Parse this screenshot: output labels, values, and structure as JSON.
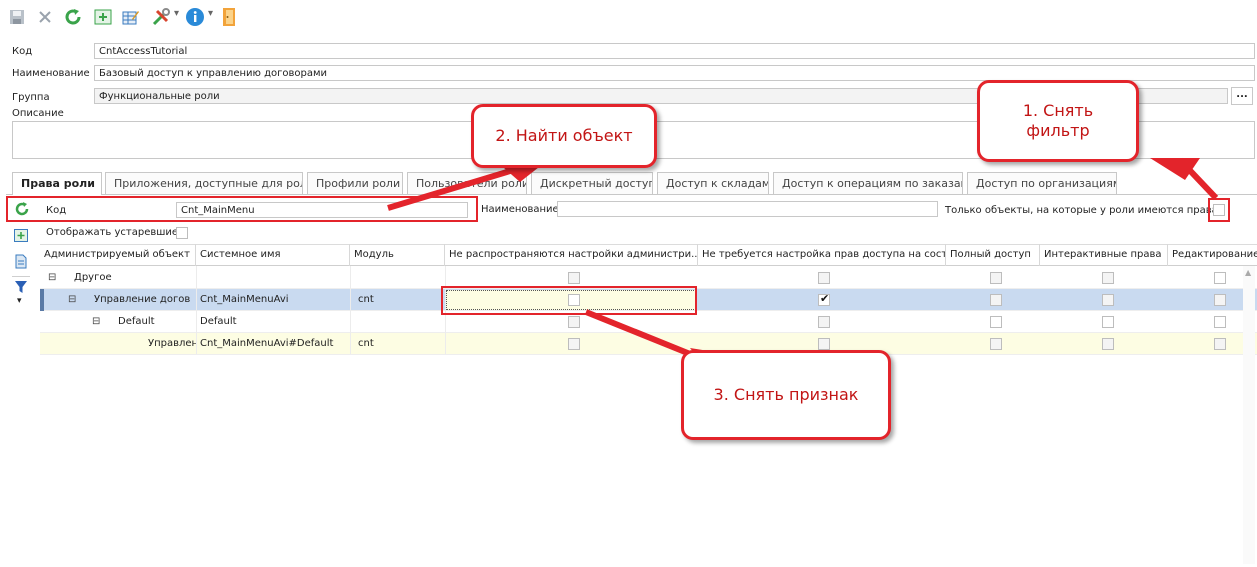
{
  "toolbar": {
    "icons": [
      "save-icon",
      "close-icon",
      "refresh-icon",
      "add-row-icon",
      "edit-table-icon",
      "tools-icon",
      "info-icon",
      "exit-door-icon"
    ]
  },
  "form": {
    "code_label": "Код",
    "code_value": "CntAccessTutorial",
    "name_label": "Наименование",
    "name_value": "Базовый доступ к управлению договорами",
    "group_label": "Группа",
    "group_value": "Функциональные роли",
    "group_button": "...",
    "description_label": "Описание"
  },
  "tabs": [
    {
      "label": "Права роли",
      "active": true
    },
    {
      "label": "Приложения, доступные для роли"
    },
    {
      "label": "Профили роли"
    },
    {
      "label": "Пользователи роли"
    },
    {
      "label": "Дискретный доступ"
    },
    {
      "label": "Доступ к складам"
    },
    {
      "label": "Доступ к операциям по заказам"
    },
    {
      "label": "Доступ по организациям"
    }
  ],
  "filter": {
    "code_label": "Код",
    "code_value": "Cnt_MainMenu",
    "name_label": "Наименование",
    "name_value": "",
    "only_objects_label": "Только объекты, на которые у роли имеются права",
    "show_obsolete_label": "Отображать устаревшие"
  },
  "grid": {
    "columns": [
      "Администрируемый объект",
      "Системное имя",
      "Модуль",
      "Не распространяются настройки администри...",
      "Не требуется настройка прав доступа на сост...",
      "Полный доступ",
      "Интерактивные права",
      "Редактирование"
    ],
    "rows": [
      {
        "object": "Другое",
        "system_name": "",
        "module": "",
        "col4": false,
        "col5": false
      },
      {
        "object": "Управление догов",
        "system_name": "Cnt_MainMenuAvi",
        "module": "cnt",
        "col4": false,
        "col5": true
      },
      {
        "object": "Default",
        "system_name": "Default",
        "module": "",
        "col4": false,
        "col5": false
      },
      {
        "object": "Управлени",
        "system_name": "Cnt_MainMenuAvi#Default",
        "module": "cnt",
        "col4": false,
        "col5": false
      }
    ]
  },
  "callouts": {
    "one": "1. Снять фильтр",
    "two": "2. Найти объект",
    "three": "3. Снять признак"
  },
  "colors": {
    "accent_red": "#e3242b",
    "selected_row": "#c9daf0",
    "highlight_row": "#fdfde3"
  }
}
